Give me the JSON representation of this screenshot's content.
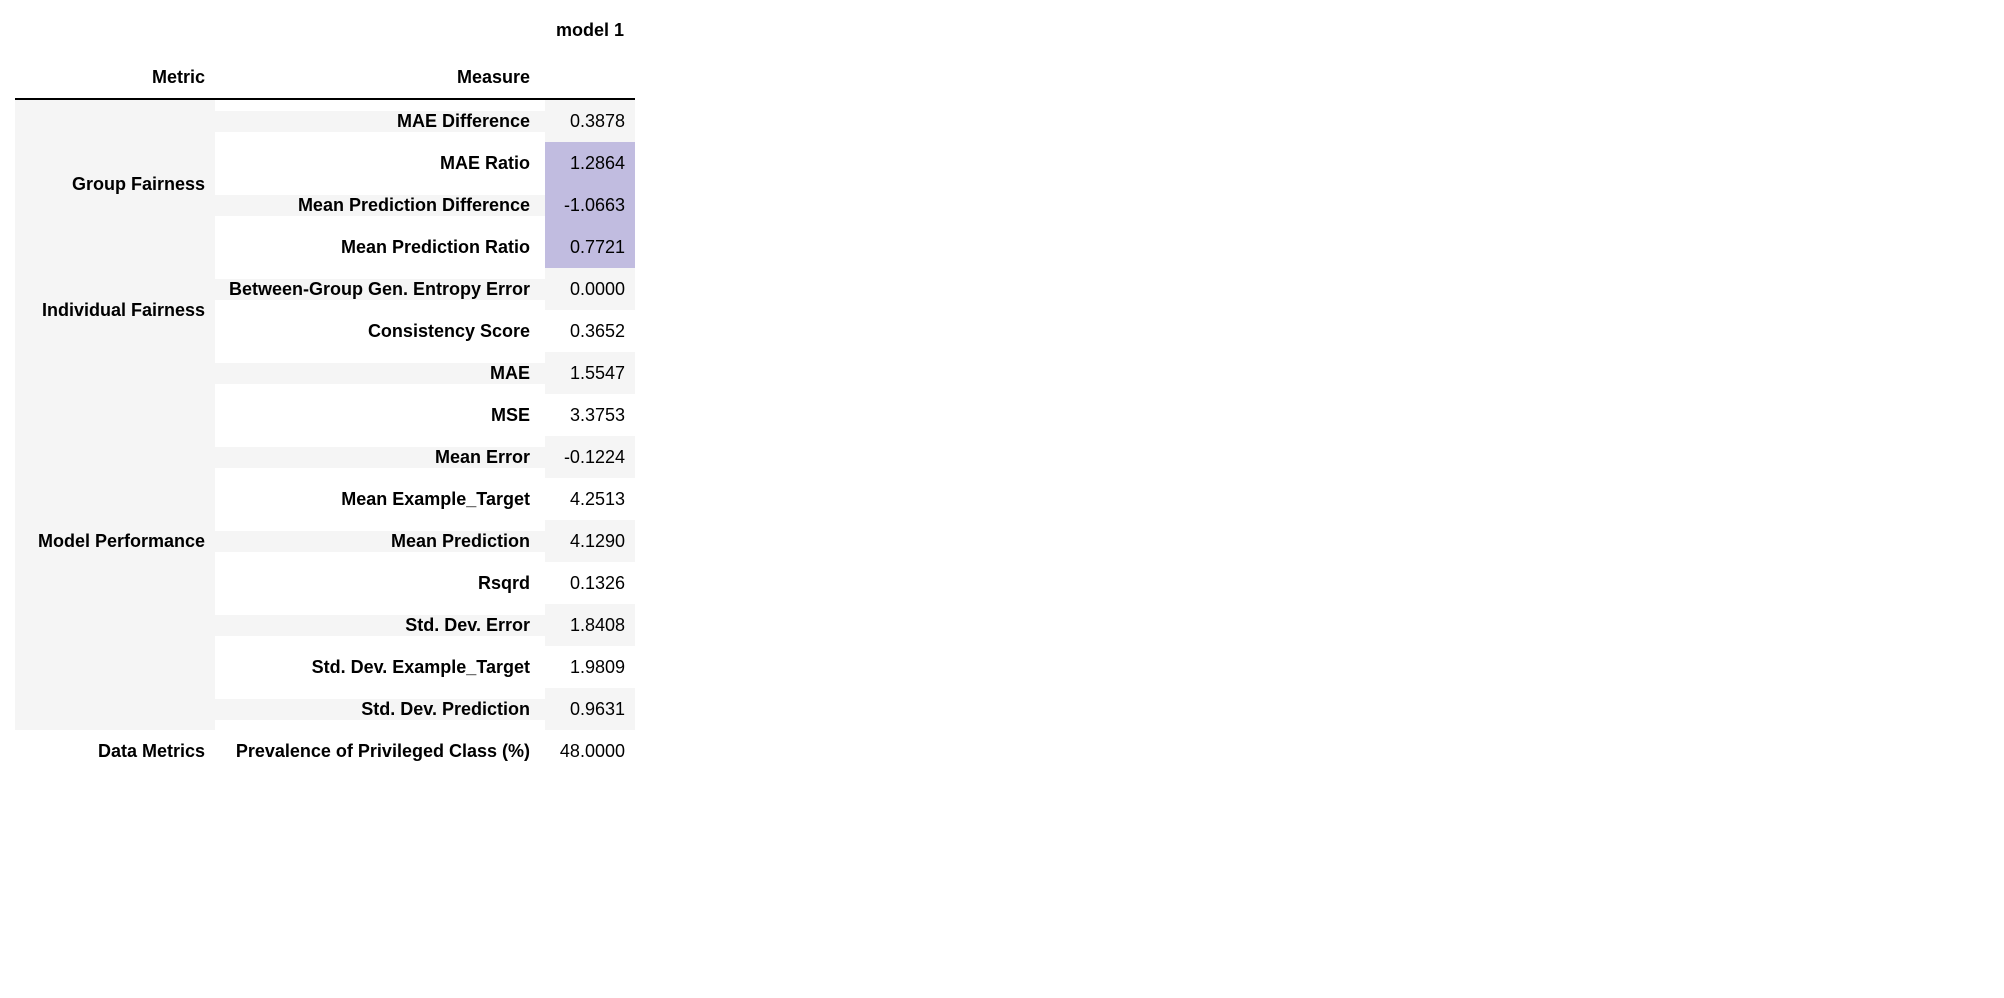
{
  "headers": {
    "model_col": "model 1",
    "metric": "Metric",
    "measure": "Measure"
  },
  "sections": [
    {
      "label": "Group Fairness",
      "rows": [
        {
          "measure": "MAE Difference",
          "value": "0.3878",
          "highlight": false
        },
        {
          "measure": "MAE Ratio",
          "value": "1.2864",
          "highlight": true
        },
        {
          "measure": "Mean Prediction Difference",
          "value": "-1.0663",
          "highlight": true
        },
        {
          "measure": "Mean Prediction Ratio",
          "value": "0.7721",
          "highlight": true
        }
      ]
    },
    {
      "label": "Individual Fairness",
      "rows": [
        {
          "measure": "Between-Group Gen. Entropy Error",
          "value": "0.0000",
          "highlight": false
        },
        {
          "measure": "Consistency Score",
          "value": "0.3652",
          "highlight": false
        }
      ]
    },
    {
      "label": "Model Performance",
      "rows": [
        {
          "measure": "MAE",
          "value": "1.5547",
          "highlight": false
        },
        {
          "measure": "MSE",
          "value": "3.3753",
          "highlight": false
        },
        {
          "measure": "Mean Error",
          "value": "-0.1224",
          "highlight": false
        },
        {
          "measure": "Mean Example_Target",
          "value": "4.2513",
          "highlight": false
        },
        {
          "measure": "Mean Prediction",
          "value": "4.1290",
          "highlight": false
        },
        {
          "measure": "Rsqrd",
          "value": "0.1326",
          "highlight": false
        },
        {
          "measure": "Std. Dev. Error",
          "value": "1.8408",
          "highlight": false
        },
        {
          "measure": "Std. Dev. Example_Target",
          "value": "1.9809",
          "highlight": false
        },
        {
          "measure": "Std. Dev. Prediction",
          "value": "0.9631",
          "highlight": false
        }
      ]
    },
    {
      "label": "Data Metrics",
      "white_bg": true,
      "rows": [
        {
          "measure": "Prevalence of Privileged Class (%)",
          "value": "48.0000",
          "highlight": false,
          "white_row": true
        }
      ]
    }
  ]
}
